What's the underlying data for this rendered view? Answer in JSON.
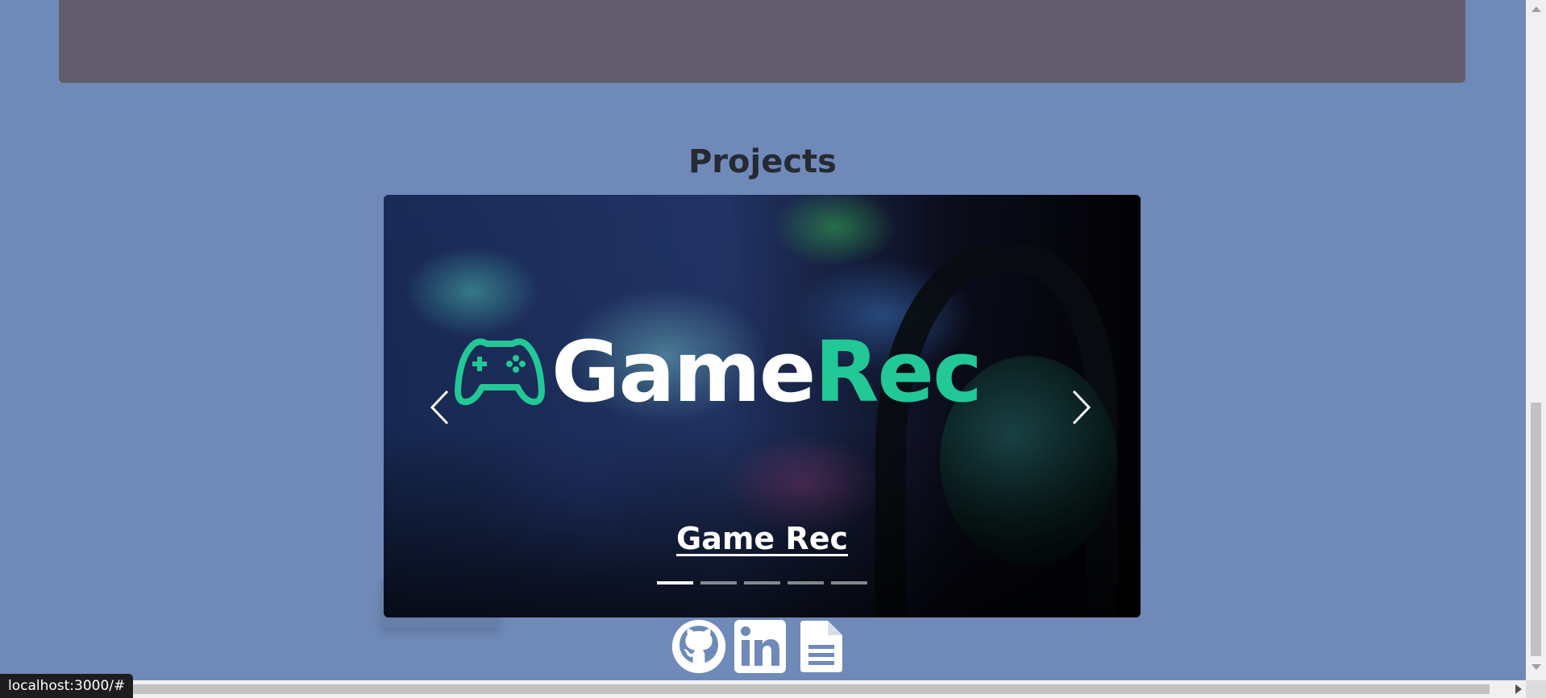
{
  "top_panel": {
    "cut_text": ""
  },
  "projects": {
    "title": "Projects",
    "carousel": {
      "logo_text_white": "Game",
      "logo_text_green": "Rec",
      "caption": "Game Rec",
      "slide_count": 5,
      "active_index": 0,
      "prev_icon": "chevron-left-icon",
      "next_icon": "chevron-right-icon"
    }
  },
  "socials": [
    {
      "icon": "github-icon"
    },
    {
      "icon": "linkedin-icon"
    },
    {
      "icon": "document-icon"
    }
  ],
  "status_bar": {
    "url": "localhost:3000/#"
  },
  "colors": {
    "background": "#6f8ab8",
    "panel": "#615d6d",
    "accent_green": "#22c896",
    "title": "#262a33"
  }
}
